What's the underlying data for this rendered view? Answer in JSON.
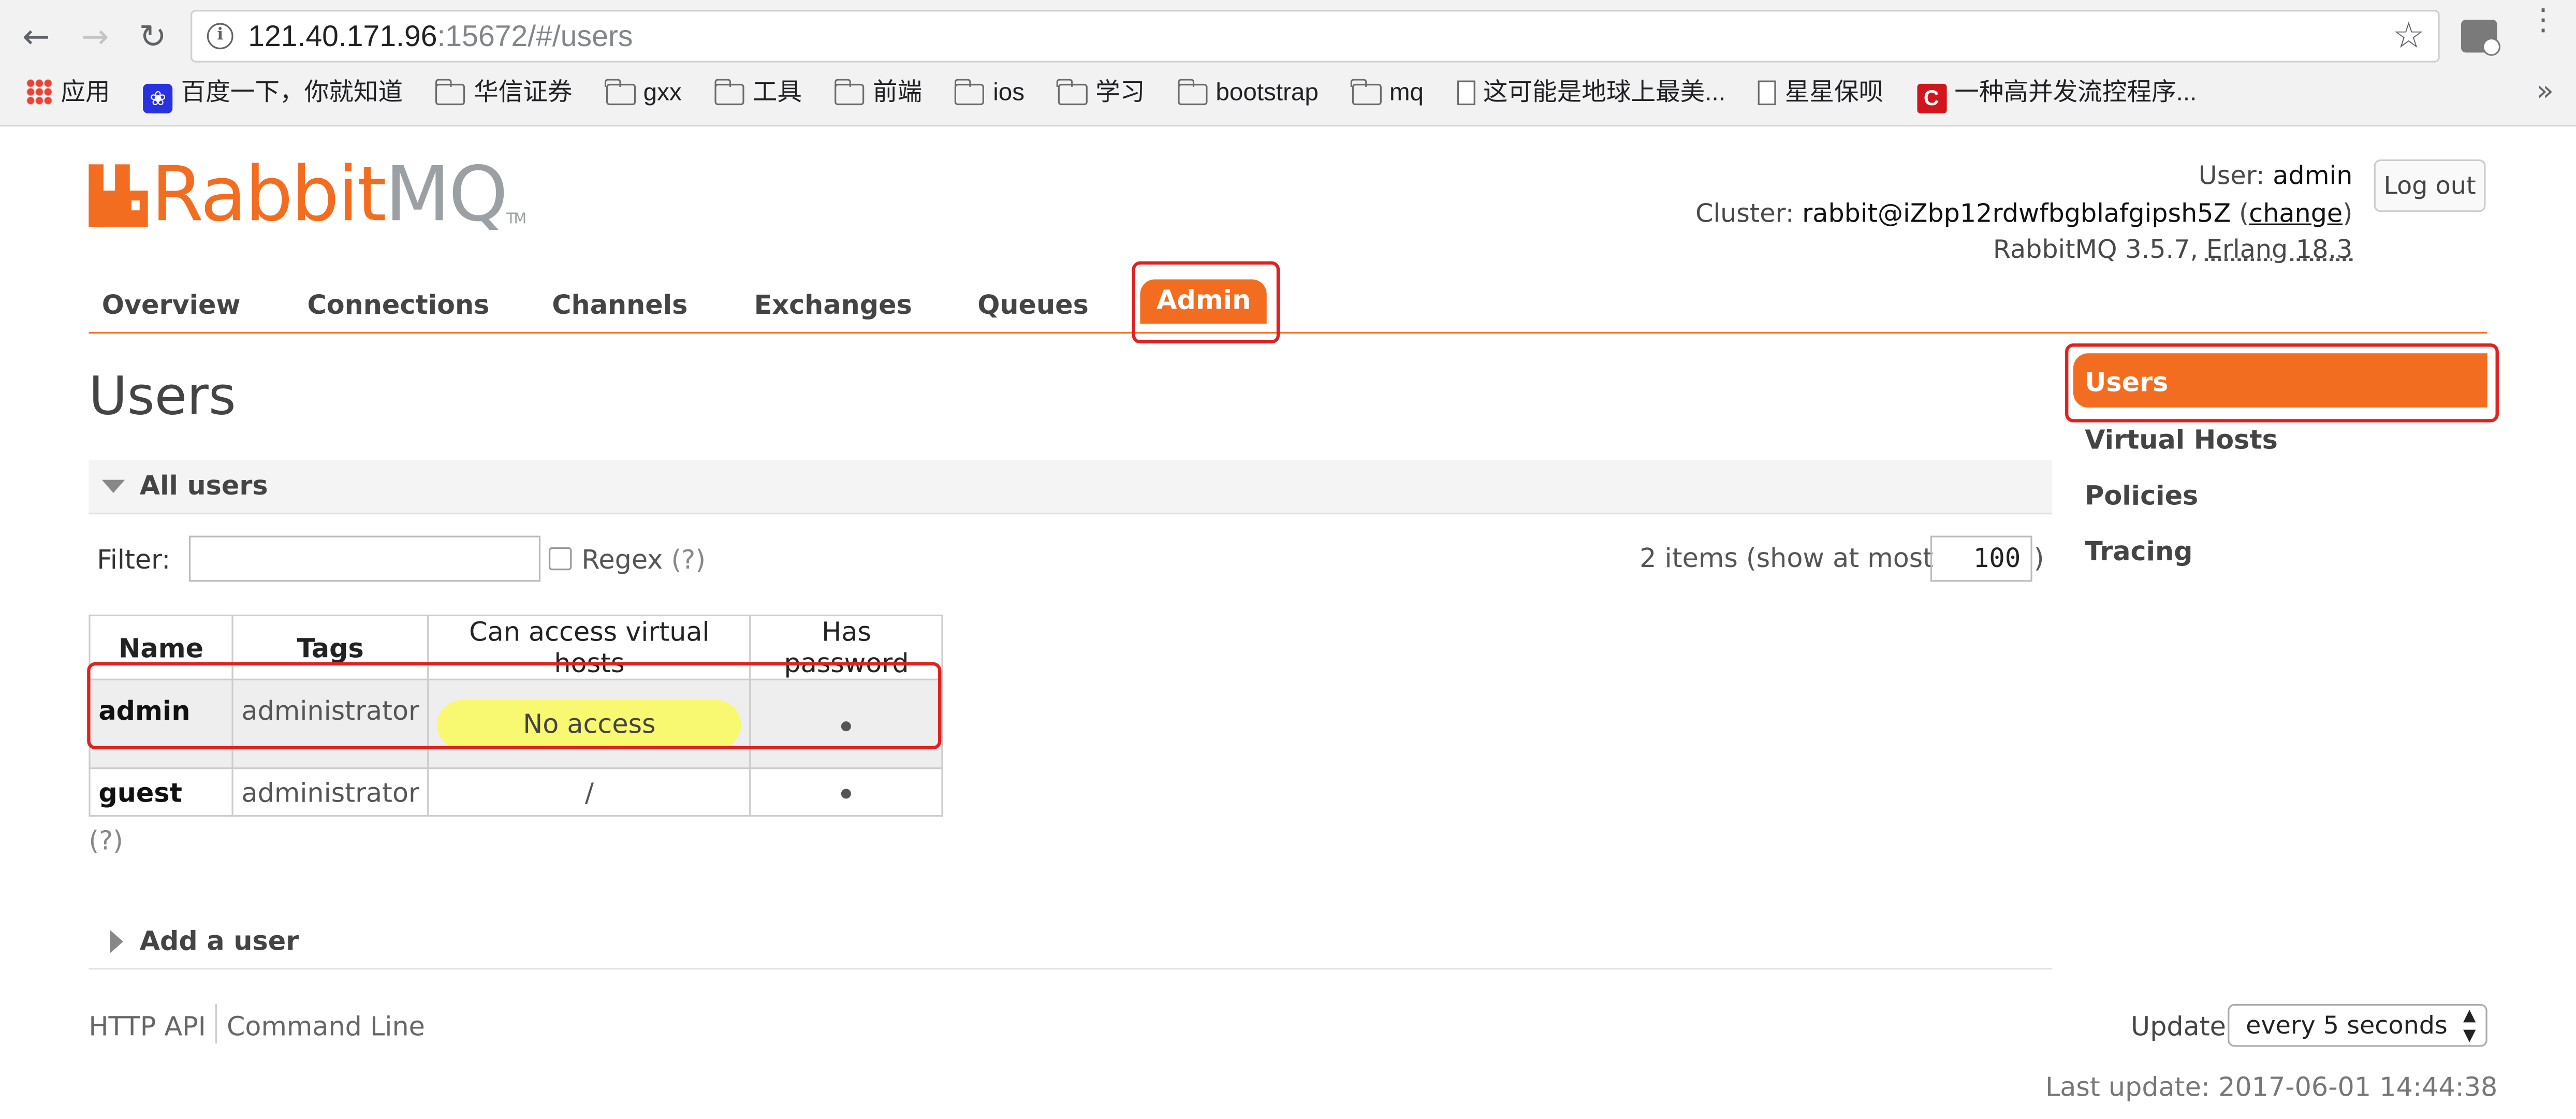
{
  "browser": {
    "url_host": "121.40.171.96",
    "url_rest": ":15672/#/users",
    "bookmarks": [
      {
        "label": "应用",
        "icon": "apps-icon"
      },
      {
        "label": "百度一下，你就知道",
        "icon": "baidu-paw-icon"
      },
      {
        "label": "华信证券",
        "icon": "folder-icon"
      },
      {
        "label": "gxx",
        "icon": "folder-icon"
      },
      {
        "label": "工具",
        "icon": "folder-icon"
      },
      {
        "label": "前端",
        "icon": "folder-icon"
      },
      {
        "label": "ios",
        "icon": "folder-icon"
      },
      {
        "label": "学习",
        "icon": "folder-icon"
      },
      {
        "label": "bootstrap",
        "icon": "folder-icon"
      },
      {
        "label": "mq",
        "icon": "folder-icon"
      },
      {
        "label": "这可能是地球上最美...",
        "icon": "page-icon"
      },
      {
        "label": "星星保呗",
        "icon": "page-icon"
      },
      {
        "label": "一种高并发流控程序...",
        "icon": "csdn-icon"
      }
    ],
    "more": "»"
  },
  "header": {
    "logo_rabbit": "Rabbit",
    "logo_mq": "MQ",
    "logo_tm": "TM",
    "user_label": "User:",
    "user_value": "admin",
    "cluster_label": "Cluster:",
    "cluster_value": "rabbit@iZbp12rdwfbgblafgipsh5Z",
    "change_label": "change",
    "version_text": "RabbitMQ 3.5.7,",
    "erlang_text": "Erlang 18.3",
    "logout_label": "Log out"
  },
  "tabs": [
    "Overview",
    "Connections",
    "Channels",
    "Exchanges",
    "Queues",
    "Admin"
  ],
  "active_tab": "Admin",
  "page_title": "Users",
  "all_users": {
    "section_label": "All users",
    "filter_label": "Filter:",
    "filter_value": "",
    "regex_label": "Regex",
    "help_q": "(?)",
    "items_text": "2 items (show at most",
    "items_max": "100",
    "items_close": ")",
    "columns": [
      "Name",
      "Tags",
      "Can access virtual hosts",
      "Has password"
    ],
    "rows": [
      {
        "name": "admin",
        "tags": "administrator",
        "vhosts": "No access",
        "has_password": true
      },
      {
        "name": "guest",
        "tags": "administrator",
        "vhosts": "/",
        "has_password": true
      }
    ],
    "footer_help": "(?)"
  },
  "add_user": {
    "section_label": "Add a user"
  },
  "footer": {
    "http_api": "HTTP API",
    "command_line": "Command Line",
    "update_label": "Update",
    "update_value": "every 5 seconds",
    "last_update": "Last update: 2017-06-01 14:44:38"
  },
  "sidebar": {
    "items": [
      "Users",
      "Virtual Hosts",
      "Policies",
      "Tracing"
    ],
    "active": "Users"
  },
  "colors": {
    "accent": "#f36d21",
    "highlight": "#e0211f",
    "no_access_bg": "#f9f871"
  }
}
